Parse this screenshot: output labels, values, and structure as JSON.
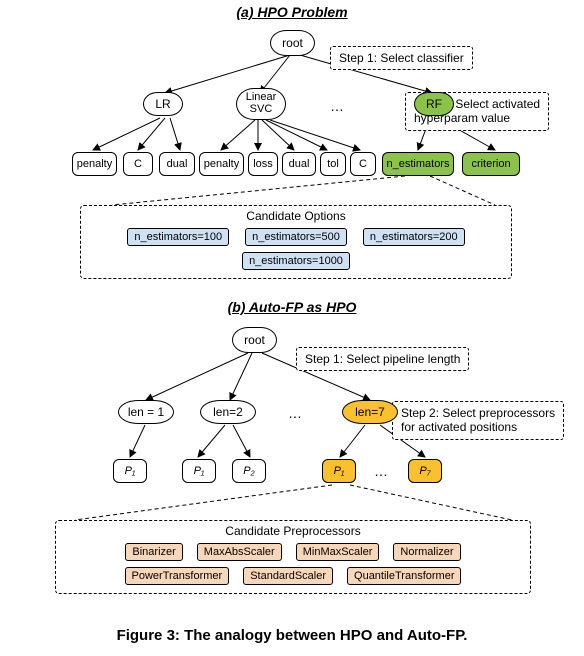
{
  "caption": "Figure 3: The analogy between HPO and Auto-FP.",
  "panelA": {
    "title": "(a) HPO Problem",
    "root": "root",
    "step1": "Step 1: Select classifier",
    "step2": "Step 2: Select activated\nhyperparam value",
    "classifiers": {
      "lr": "LR",
      "svc": "Linear\nSVC",
      "rf": "RF"
    },
    "ellipsis": "…",
    "leaves": {
      "lr": [
        "penalty",
        "C",
        "dual"
      ],
      "svc": [
        "penalty",
        "loss",
        "dual",
        "tol",
        "C"
      ],
      "rf": [
        "n_estimators",
        "criterion"
      ]
    },
    "options": {
      "title": "Candidate Options",
      "items": [
        "n_estimators=100",
        "n_estimators=500",
        "n_estimators=200",
        "n_estimators=1000"
      ]
    }
  },
  "panelB": {
    "title": "(b) Auto-FP as HPO",
    "root": "root",
    "step1": "Step 1: Select pipeline length",
    "step2": "Step 2: Select preprocessors\nfor activated positions",
    "lens": {
      "l1": "len = 1",
      "l2": "len=2",
      "l7": "len=7"
    },
    "ellipsis": "…",
    "leaves": {
      "p1": "P₁",
      "p2": "P₂",
      "p7": "P₇"
    },
    "options": {
      "title": "Candidate Preprocessors",
      "row1": [
        "Binarizer",
        "MaxAbsScaler",
        "MinMaxScaler",
        "Normalizer"
      ],
      "row2": [
        "PowerTransformer",
        "StandardScaler",
        "QuantileTransformer"
      ]
    }
  }
}
